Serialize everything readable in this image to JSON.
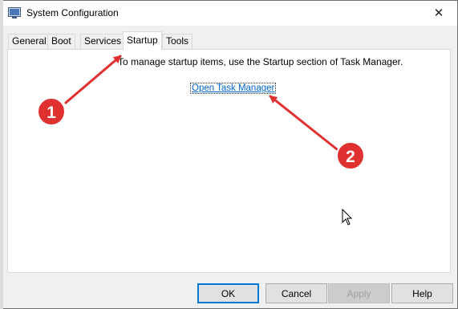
{
  "window": {
    "title": "System Configuration",
    "close_icon": "close-icon",
    "app_icon": "msconfig-icon"
  },
  "tabs": [
    {
      "label": "General",
      "active": false
    },
    {
      "label": "Boot",
      "active": false
    },
    {
      "label": "Services",
      "active": false
    },
    {
      "label": "Startup",
      "active": true
    },
    {
      "label": "Tools",
      "active": false
    }
  ],
  "panel": {
    "info_text": "To manage startup items, use the Startup section of Task Manager.",
    "link_label": "Open Task Manager"
  },
  "buttons": {
    "ok": "OK",
    "cancel": "Cancel",
    "apply": "Apply",
    "help": "Help"
  },
  "annotations": [
    {
      "number": "1",
      "color": "#e03131"
    },
    {
      "number": "2",
      "color": "#e03131"
    }
  ],
  "colors": {
    "link": "#0066cc",
    "annotation": "#e03131",
    "focus_border": "#0078d7"
  }
}
